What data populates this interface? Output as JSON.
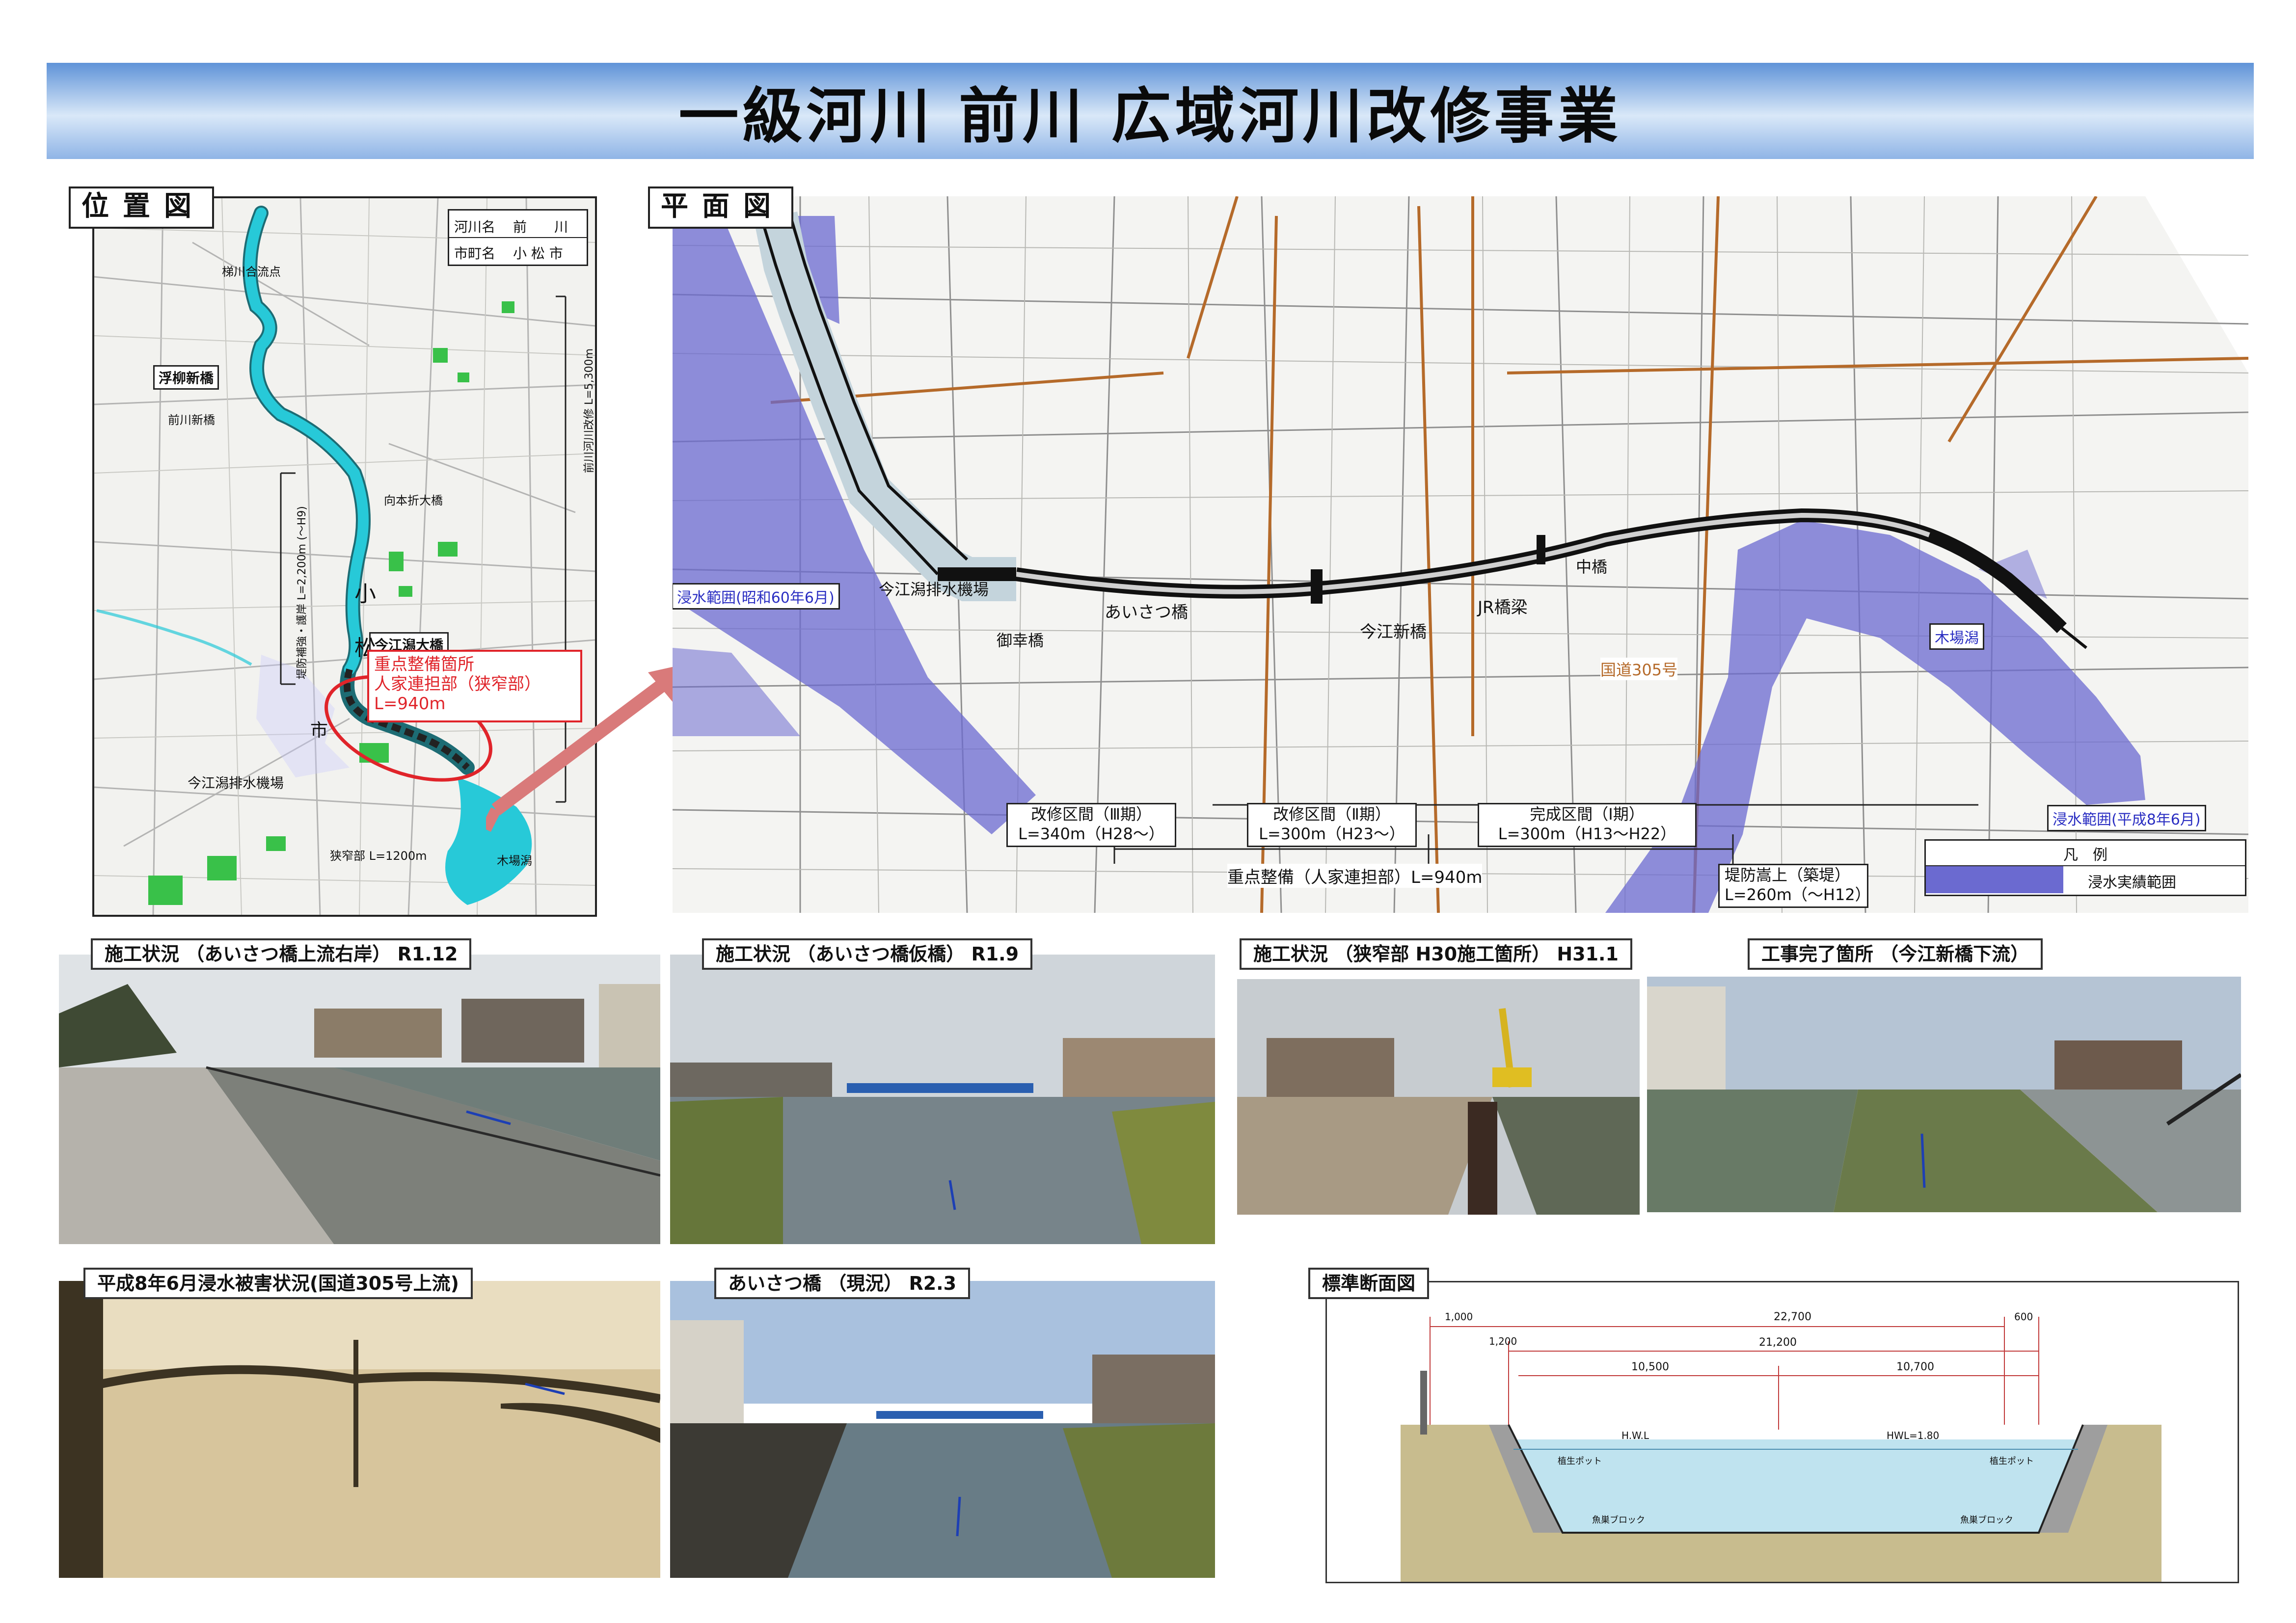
{
  "title": "一級河川 前川 広域河川改修事業",
  "location_map": {
    "tag": "位置図",
    "info_table": [
      {
        "label": "河川名",
        "value": "前　　川"
      },
      {
        "label": "市町名",
        "value": "小 松 市"
      }
    ],
    "labels": {
      "confluence": "梯川合流点",
      "bridge_ukiyanagi": "浮柳新橋",
      "bridge_maekawa": "前川新橋",
      "bridge_mukaimoto": "向本折大橋",
      "bridge_imae": "今江潟大橋",
      "city_ko": "小",
      "city_matsu": "松",
      "city_shi": "市",
      "pump": "今江潟排水機場",
      "kibagata": "木場潟",
      "narrow_short": "狭窄部 L=1200m",
      "total_length": "前川河川改修 L=5,300m",
      "levee_length": "堤防補強・護岸 L=2,200m (〜H9)"
    },
    "callout": {
      "line1": "重点整備箇所",
      "line2": "人家連担部（狭窄部）",
      "line3": "L=940m"
    }
  },
  "plan_map": {
    "tag": "平面図",
    "flood_1985": "浸水範囲(昭和60年6月)",
    "flood_1996": "浸水範囲(平成8年6月)",
    "labels": {
      "pump": "今江潟排水機場",
      "bridge_gokou": "御幸橋",
      "bridge_aisatsu": "あいさつ橋",
      "bridge_imae": "今江新橋",
      "bridge_jr": "JR橋梁",
      "bridge_naka": "中橋",
      "route305": "国道305号",
      "kibagata": "木場潟"
    },
    "sections": [
      {
        "name": "改修区間（Ⅲ期）",
        "detail": "L=340m（H28〜）"
      },
      {
        "name": "改修区間（Ⅱ期）",
        "detail": "L=300m（H23〜）"
      },
      {
        "name": "完成区間（Ⅰ期）",
        "detail": "L=300m（H13〜H22）"
      }
    ],
    "priority_total": "重点整備（人家連担部）L=940m",
    "levee": {
      "line1": "堤防嵩上（築堤）",
      "line2": "L=260m（〜H12）"
    },
    "legend": {
      "title": "凡　例",
      "item": "浸水実績範囲",
      "color": "#6b6ad0"
    }
  },
  "photos": [
    {
      "caption": "施工状況 （あいさつ橋上流右岸） R1.12"
    },
    {
      "caption": "施工状況 （あいさつ橋仮橋） R1.9"
    },
    {
      "caption": "施工状況 （狭窄部 H30施工箇所） H31.1"
    },
    {
      "caption": "工事完了箇所 （今江新橋下流）"
    },
    {
      "caption": "平成8年6月浸水被害状況(国道305号上流)"
    },
    {
      "caption": "あいさつ橋 （現況） R2.3"
    }
  ],
  "section_drawing": {
    "tag": "標準断面図",
    "overall": "22,700",
    "inner": "21,200",
    "left_half": "10,500",
    "right_half": "10,700",
    "hwl": "HWL=1.80",
    "hwl_mark": "H.W.L",
    "left_top": "1,000",
    "left_setback": "1,200",
    "right_top": "600",
    "left_block": "魚巣ブロック",
    "right_block": "魚巣ブロック",
    "left_pot": "植生ポット",
    "right_pot": "植生ポット"
  },
  "colors": {
    "accent_red": "#e0242a",
    "river_cyan": "#27c9d8",
    "flood_purple": "#6b6ad0",
    "title_blue": "#5f93d8"
  }
}
